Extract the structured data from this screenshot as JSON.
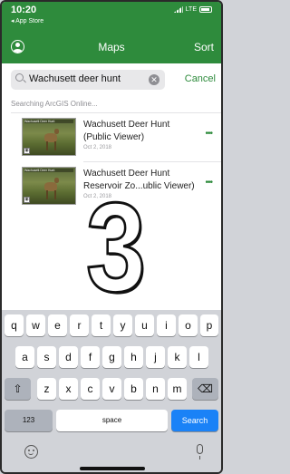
{
  "status_bar": {
    "time": "10:20",
    "back_app": "◂ App Store",
    "carrier": "LTE"
  },
  "nav": {
    "title": "Maps",
    "sort_label": "Sort"
  },
  "search": {
    "value": "Wachusett deer hunt",
    "cancel_label": "Cancel"
  },
  "searching_label": "Searching ArcGIS Online...",
  "results": [
    {
      "title_line1": "Wachusett Deer Hunt",
      "title_line2": "(Public Viewer)",
      "date": "Oct 2, 2018",
      "thumb_caption": "Wachusett Deer Hunt"
    },
    {
      "title_line1": "Wachusett Deer Hunt",
      "title_line2": "Reservoir Zo...ublic Viewer)",
      "date": "Oct 2, 2018",
      "thumb_caption": "Wachusett Deer Hunt"
    }
  ],
  "overlay_number": "3",
  "keyboard": {
    "row1": [
      "q",
      "w",
      "e",
      "r",
      "t",
      "y",
      "u",
      "i",
      "o",
      "p"
    ],
    "row2": [
      "a",
      "s",
      "d",
      "f",
      "g",
      "h",
      "j",
      "k",
      "l"
    ],
    "row3": [
      "z",
      "x",
      "c",
      "v",
      "b",
      "n",
      "m"
    ],
    "numbers_label": "123",
    "space_label": "space",
    "go_label": "Search"
  },
  "colors": {
    "accent": "#2e8b3c",
    "key_blue": "#1a82f7"
  },
  "icons": [
    "profile-icon",
    "search-icon",
    "clear-icon",
    "more-icon",
    "shift-icon",
    "backspace-icon",
    "emoji-icon",
    "mic-icon"
  ]
}
